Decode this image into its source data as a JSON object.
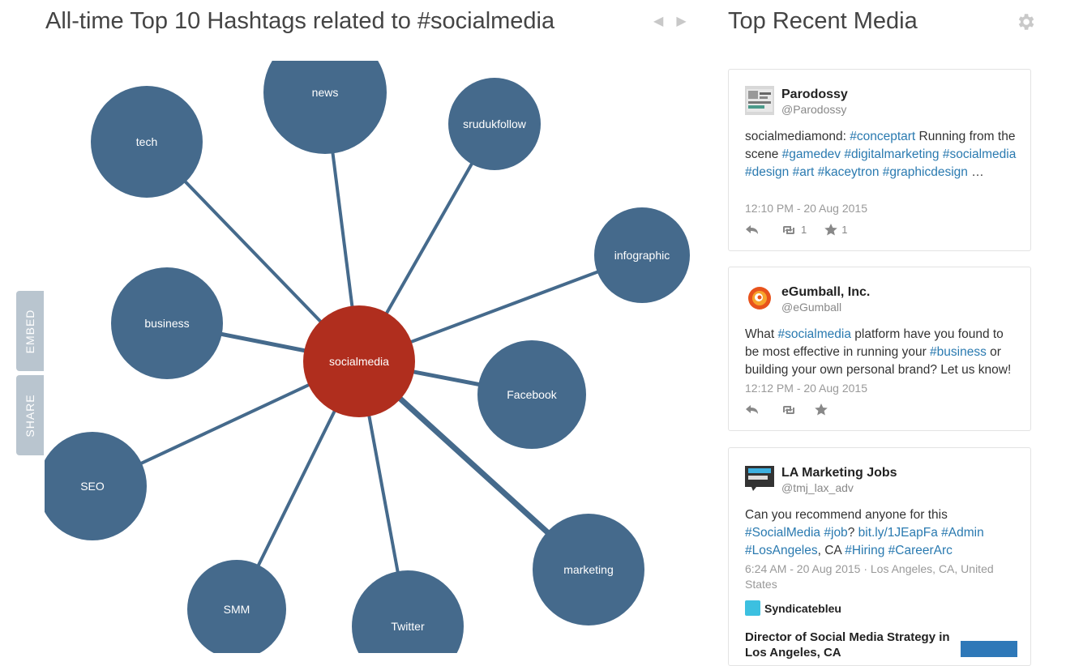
{
  "left_panel": {
    "title": "All-time Top 10 Hashtags related to #socialmedia",
    "prev_icon": "triangle-left",
    "next_icon": "triangle-right"
  },
  "side_tabs": {
    "embed": "EMBED",
    "share": "SHARE"
  },
  "graph": {
    "center": "socialmedia",
    "center_color": "#b02e1e",
    "node_color": "#456a8c",
    "edge_color": "#456a8c",
    "nodes": [
      "news",
      "tech",
      "srudukfollow",
      "infographic",
      "business",
      "Facebook",
      "SEO",
      "marketing",
      "SMM",
      "Twitter"
    ]
  },
  "right_panel": {
    "title": "Top Recent Media",
    "settings_icon": "gear-icon"
  },
  "tweets": [
    {
      "name": "Parodossy",
      "handle": "@Parodossy",
      "text_parts": [
        {
          "t": "socialmediamond: ",
          "tag": false
        },
        {
          "t": "#conceptart",
          "tag": true
        },
        {
          "t": " Running from the scene ",
          "tag": false
        },
        {
          "t": "#gamedev",
          "tag": true
        },
        {
          "t": " ",
          "tag": false
        },
        {
          "t": "#digitalmarketing",
          "tag": true
        },
        {
          "t": " ",
          "tag": false
        },
        {
          "t": "#socialmedia",
          "tag": true
        },
        {
          "t": " ",
          "tag": false
        },
        {
          "t": "#design",
          "tag": true
        },
        {
          "t": " ",
          "tag": false
        },
        {
          "t": "#art",
          "tag": true
        },
        {
          "t": " ",
          "tag": false
        },
        {
          "t": "#kaceytron",
          "tag": true
        },
        {
          "t": " ",
          "tag": false
        },
        {
          "t": "#graphicdesign",
          "tag": true
        },
        {
          "t": " …",
          "tag": false
        }
      ],
      "time": "12:10 PM - 20 Aug 2015",
      "retweets": "1",
      "favorites": "1"
    },
    {
      "name": "eGumball, Inc.",
      "handle": "@eGumball",
      "text_parts": [
        {
          "t": "What ",
          "tag": false
        },
        {
          "t": "#socialmedia",
          "tag": true
        },
        {
          "t": " platform have you found to be most effective in running your ",
          "tag": false
        },
        {
          "t": "#business",
          "tag": true
        },
        {
          "t": " or building your own personal brand? Let us know!",
          "tag": false
        }
      ],
      "time": "12:12 PM - 20 Aug 2015",
      "retweets": "",
      "favorites": ""
    },
    {
      "name": "LA Marketing Jobs",
      "handle": "@tmj_lax_adv",
      "text_parts": [
        {
          "t": "Can you recommend anyone for this ",
          "tag": false
        },
        {
          "t": "#SocialMedia",
          "tag": true
        },
        {
          "t": " ",
          "tag": false
        },
        {
          "t": "#job",
          "tag": true
        },
        {
          "t": "? ",
          "tag": false
        },
        {
          "t": "bit.ly/1JEapFa",
          "tag": true
        },
        {
          "t": " ",
          "tag": false
        },
        {
          "t": "#Admin",
          "tag": true
        },
        {
          "t": " ",
          "tag": false
        },
        {
          "t": "#LosAngeles",
          "tag": true
        },
        {
          "t": ", CA ",
          "tag": false
        },
        {
          "t": "#Hiring",
          "tag": true
        },
        {
          "t": " ",
          "tag": false
        },
        {
          "t": "#CareerArc",
          "tag": true
        }
      ],
      "time": "6:24 AM - 20 Aug 2015 · Los Angeles, CA, United States",
      "source": "Syndicatebleu",
      "job_title": "Director of Social Media Strategy in Los Angeles, CA"
    }
  ]
}
